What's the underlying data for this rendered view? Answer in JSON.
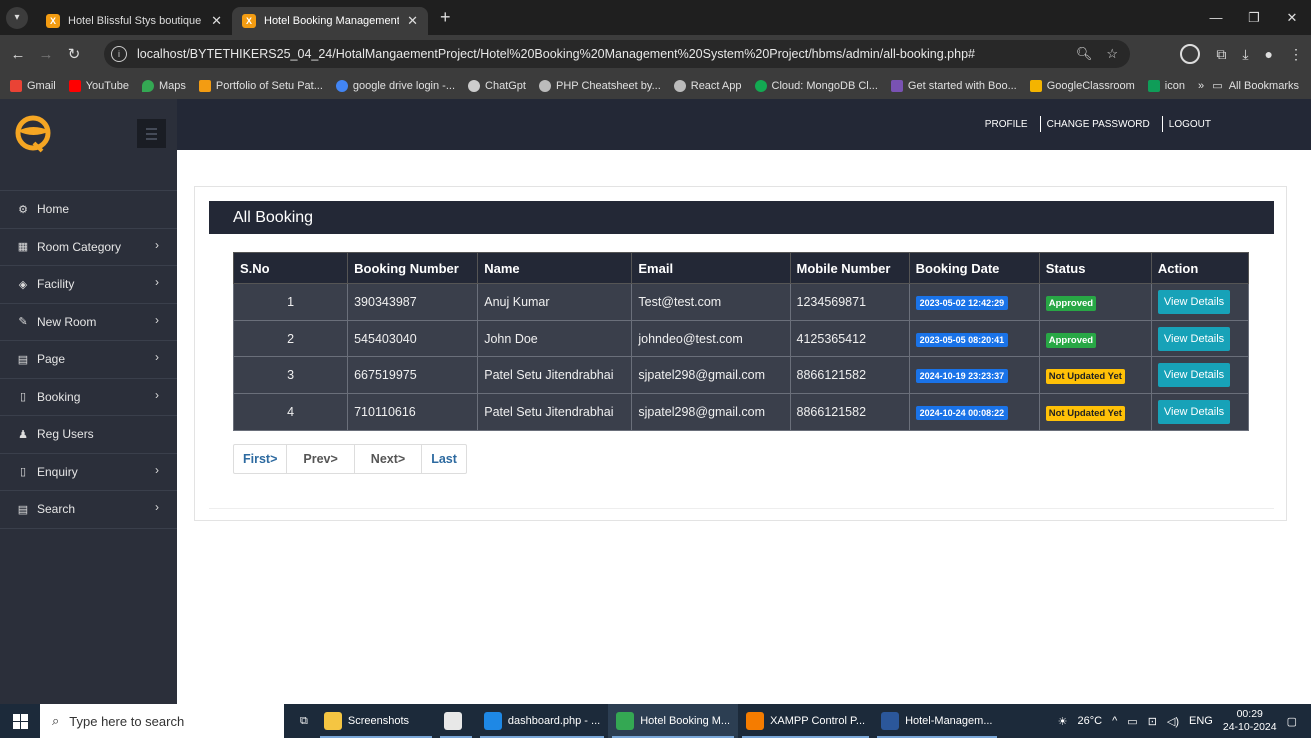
{
  "browser": {
    "tabs": [
      {
        "title": "Hotel Blissful Stys boutique | H",
        "active": false
      },
      {
        "title": "Hotel Booking Management Sy",
        "active": true
      }
    ],
    "url": "localhost/BYTETHIKERS25_04_24/HotalMangaementProject/Hotel%20Booking%20Management%20System%20Project/hbms/admin/all-booking.php#",
    "bookmarks": [
      "Gmail",
      "YouTube",
      "Maps",
      "Portfolio of Setu Pat...",
      "google drive login -...",
      "ChatGpt",
      "PHP Cheatsheet by...",
      "React App",
      "Cloud: MongoDB Cl...",
      "Get started with Boo...",
      "GoogleClassroom",
      "icon"
    ],
    "bookmarks_more": "»",
    "all_bookmarks": "All Bookmarks"
  },
  "topnav": {
    "profile": "PROFILE",
    "change_password": "CHANGE PASSWORD",
    "logout": "LOGOUT"
  },
  "sidebar": {
    "items": [
      {
        "label": "Home",
        "icon": "dashboard-icon",
        "glyph": "⚙",
        "has_sub": false
      },
      {
        "label": "Room Category",
        "icon": "grid-icon",
        "glyph": "▦",
        "has_sub": true
      },
      {
        "label": "Facility",
        "icon": "layers-icon",
        "glyph": "◈",
        "has_sub": true
      },
      {
        "label": "New Room",
        "icon": "pencil-icon",
        "glyph": "✎",
        "has_sub": true
      },
      {
        "label": "Page",
        "icon": "file-icon",
        "glyph": "▤",
        "has_sub": true
      },
      {
        "label": "Booking",
        "icon": "file-icon",
        "glyph": "▯",
        "has_sub": true
      },
      {
        "label": "Reg Users",
        "icon": "users-icon",
        "glyph": "♟",
        "has_sub": false
      },
      {
        "label": "Enquiry",
        "icon": "file-icon",
        "glyph": "▯",
        "has_sub": true
      },
      {
        "label": "Search",
        "icon": "file-icon",
        "glyph": "▤",
        "has_sub": true
      }
    ]
  },
  "main": {
    "title": "All Booking",
    "columns": [
      "S.No",
      "Booking Number",
      "Name",
      "Email",
      "Mobile Number",
      "Booking Date",
      "Status",
      "Action"
    ],
    "rows": [
      {
        "sno": "1",
        "booking_number": "390343987",
        "name": "Anuj Kumar",
        "email": "Test@test.com",
        "mobile": "1234569871",
        "date": "2023-05-02 12:42:29",
        "status": "Approved",
        "status_type": "ok",
        "action": "View Details"
      },
      {
        "sno": "2",
        "booking_number": "545403040",
        "name": "John Doe",
        "email": "johndeo@test.com",
        "mobile": "4125365412",
        "date": "2023-05-05 08:20:41",
        "status": "Approved",
        "status_type": "ok",
        "action": "View Details"
      },
      {
        "sno": "3",
        "booking_number": "667519975",
        "name": "Patel Setu Jitendrabhai",
        "email": "sjpatel298@gmail.com",
        "mobile": "8866121582",
        "date": "2024-10-19 23:23:37",
        "status": "Not Updated Yet",
        "status_type": "pend",
        "action": "View Details"
      },
      {
        "sno": "4",
        "booking_number": "710110616",
        "name": "Patel Setu Jitendrabhai",
        "email": "sjpatel298@gmail.com",
        "mobile": "8866121582",
        "date": "2024-10-24 00:08:22",
        "status": "Not Updated Yet",
        "status_type": "pend",
        "action": "View Details"
      }
    ],
    "pager": {
      "first": "First>",
      "prev": "Prev>",
      "next": "Next>",
      "last": "Last"
    }
  },
  "taskbar": {
    "search_placeholder": "Type here to search",
    "apps": [
      {
        "label": "Screenshots",
        "icon": "folder-icon",
        "color": "#f5c542"
      },
      {
        "label": "",
        "icon": "file-icon",
        "color": "#e8e8e8"
      },
      {
        "label": "dashboard.php - ...",
        "icon": "vscode-icon",
        "color": "#1e88e5"
      },
      {
        "label": "Hotel Booking M...",
        "icon": "chrome-icon",
        "color": "#34a853"
      },
      {
        "label": "XAMPP Control P...",
        "icon": "xampp-icon",
        "color": "#f57c00"
      },
      {
        "label": "Hotel-Managem...",
        "icon": "word-icon",
        "color": "#2b579a"
      }
    ],
    "temperature": "26°C",
    "language": "ENG",
    "time": "00:29",
    "date": "24-10-2024"
  },
  "colors": {
    "sidebar": "#2b2f3a",
    "header": "#232836",
    "date_badge": "#1a73e8",
    "approved": "#28a745",
    "pending": "#ffc107",
    "view_button": "#17a2b8"
  }
}
